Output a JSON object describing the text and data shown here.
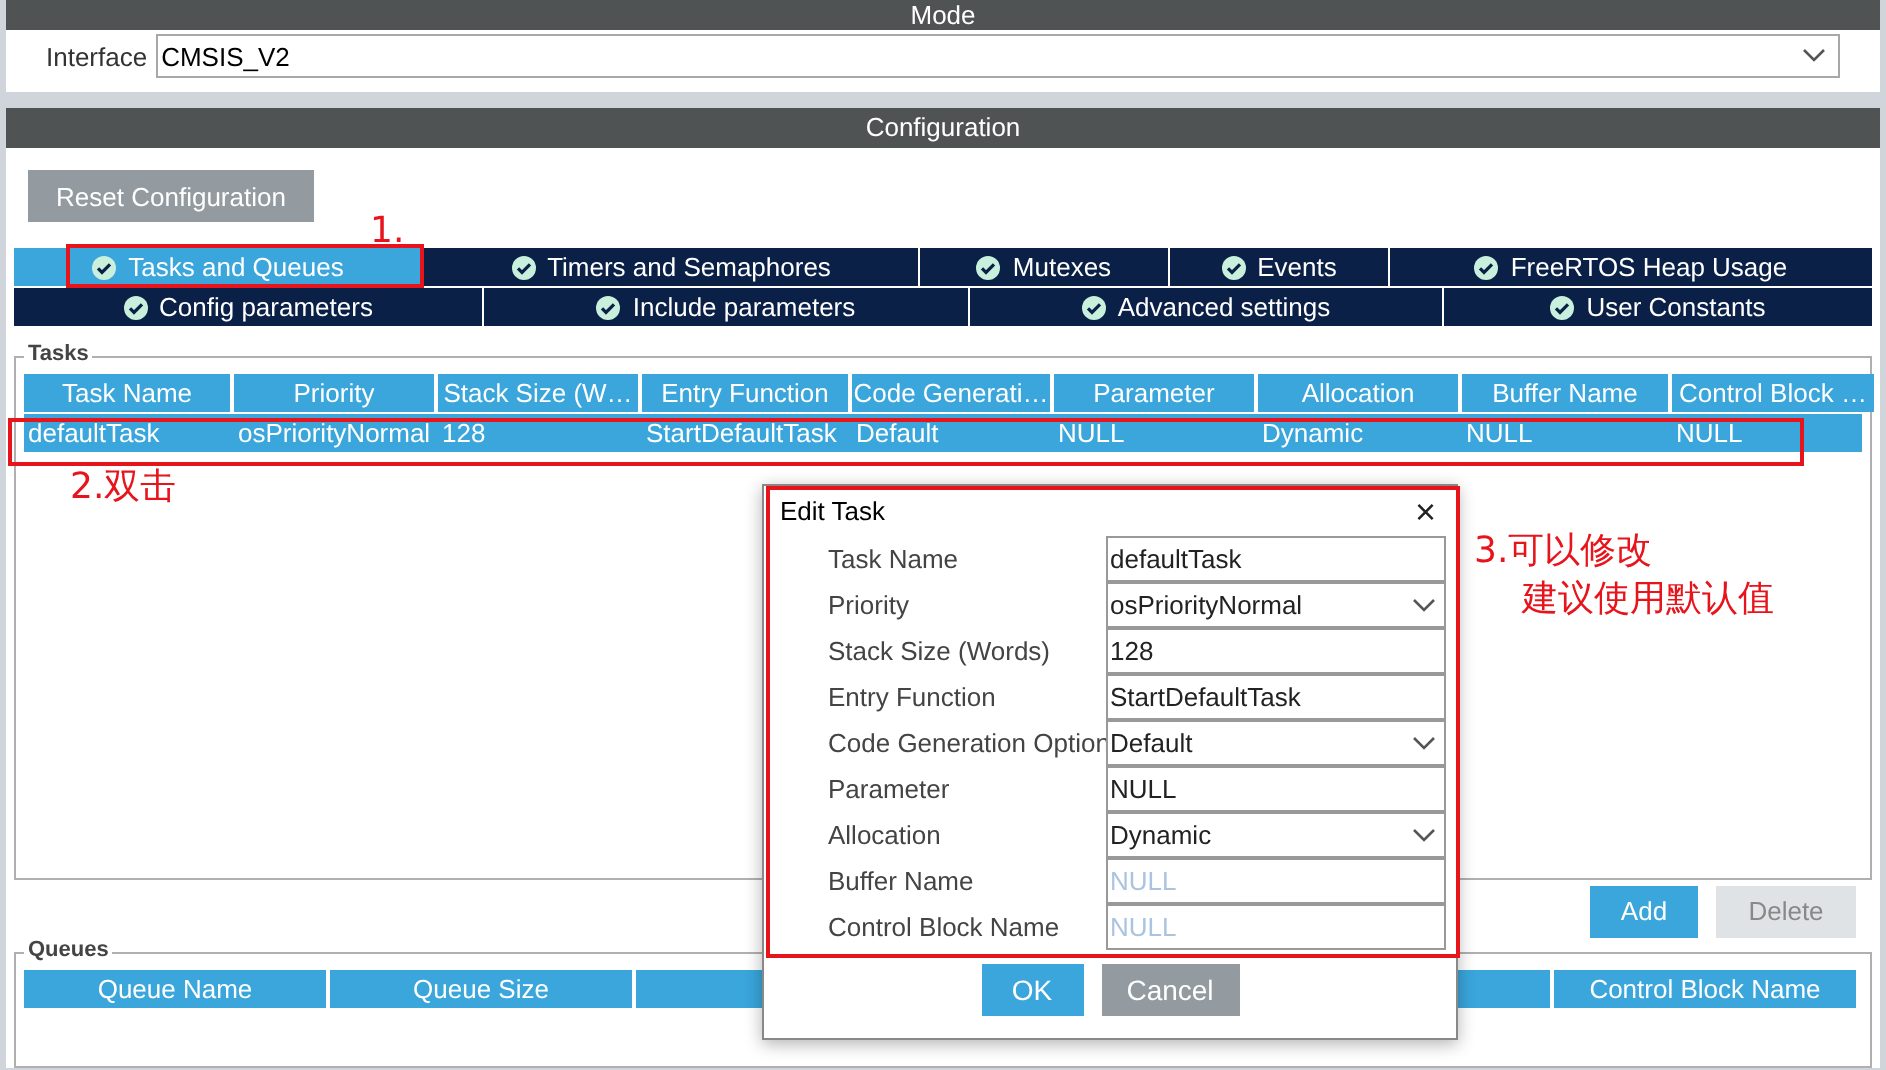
{
  "mode_header": {
    "title": "Mode"
  },
  "interface": {
    "label": "Interface",
    "value": "CMSIS_V2"
  },
  "configuration": {
    "title": "Configuration",
    "reset_button": "Reset Configuration"
  },
  "tabs": [
    [
      {
        "label": "Tasks and Queues",
        "selected": true
      },
      {
        "label": "Timers and Semaphores",
        "selected": false
      },
      {
        "label": "Mutexes",
        "selected": false
      },
      {
        "label": "Events",
        "selected": false
      },
      {
        "label": "FreeRTOS Heap Usage",
        "selected": false
      }
    ],
    [
      {
        "label": "Config parameters",
        "selected": false
      },
      {
        "label": "Include parameters",
        "selected": false
      },
      {
        "label": "Advanced settings",
        "selected": false
      },
      {
        "label": "User Constants",
        "selected": false
      }
    ]
  ],
  "tasks": {
    "title": "Tasks",
    "columns": [
      "Task Name",
      "Priority",
      "Stack Size (W…",
      "Entry Function",
      "Code Generati…",
      "Parameter",
      "Allocation",
      "Buffer Name",
      "Control Block …"
    ],
    "rows": [
      {
        "cells": [
          "defaultTask",
          "osPriorityNormal",
          "128",
          "StartDefaultTask",
          "Default",
          "NULL",
          "Dynamic",
          "NULL",
          "NULL"
        ],
        "selected": true
      }
    ],
    "buttons": [
      {
        "label": "Add",
        "disabled": false
      },
      {
        "label": "Delete",
        "disabled": true
      }
    ]
  },
  "queues": {
    "title": "Queues",
    "columns": [
      "Queue Name",
      "Queue Size",
      "Control Block Name"
    ]
  },
  "dialog": {
    "title": "Edit Task",
    "close": "×",
    "fields": [
      {
        "label": "Task Name",
        "value": "defaultTask",
        "kind": "input",
        "disabled": false
      },
      {
        "label": "Priority",
        "value": "osPriorityNormal",
        "kind": "select",
        "disabled": false
      },
      {
        "label": "Stack Size (Words)",
        "value": "128",
        "kind": "input",
        "disabled": false
      },
      {
        "label": "Entry Function",
        "value": "StartDefaultTask",
        "kind": "input",
        "disabled": false
      },
      {
        "label": "Code Generation Option",
        "value": "Default",
        "kind": "select",
        "disabled": false
      },
      {
        "label": "Parameter",
        "value": "NULL",
        "kind": "input",
        "disabled": false
      },
      {
        "label": "Allocation",
        "value": "Dynamic",
        "kind": "select",
        "disabled": false
      },
      {
        "label": "Buffer Name",
        "value": "NULL",
        "kind": "input",
        "disabled": true
      },
      {
        "label": "Control Block Name",
        "value": "NULL",
        "kind": "input",
        "disabled": true
      }
    ],
    "buttons": [
      {
        "label": "OK",
        "kind": "primary"
      },
      {
        "label": "Cancel",
        "kind": "secondary"
      }
    ]
  },
  "annotations": [
    {
      "lines": [
        "1."
      ]
    },
    {
      "lines": [
        "2.双击"
      ]
    },
    {
      "lines": [
        "3.可以修改",
        "建议使用默认值"
      ]
    }
  ]
}
